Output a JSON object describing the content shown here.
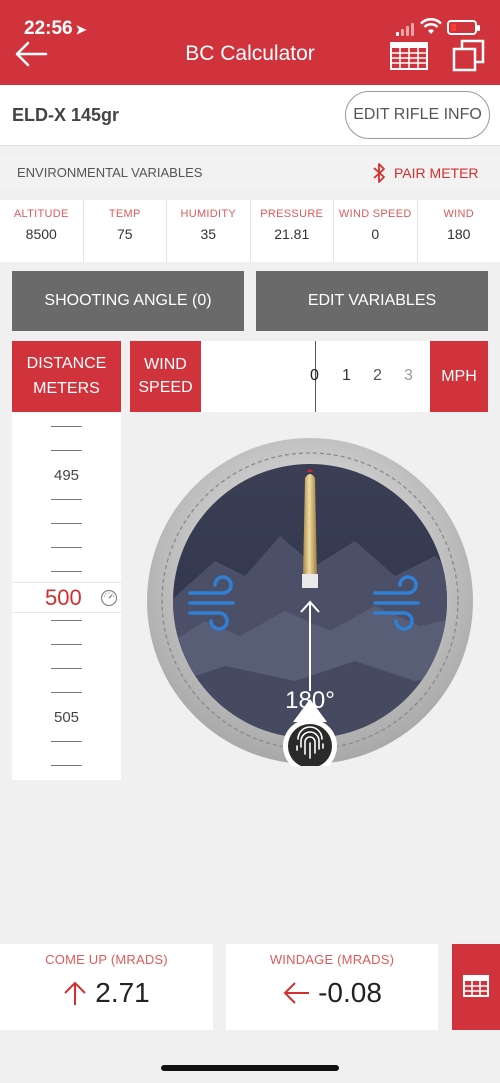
{
  "status": {
    "time": "22:56"
  },
  "header": {
    "title": "BC Calculator"
  },
  "ammo": {
    "name": "ELD-X 145gr",
    "edit_rifle_label": "EDIT RIFLE INFO"
  },
  "env": {
    "title": "ENVIRONMENTAL VARIABLES",
    "pair_meter_label": "PAIR METER",
    "items": [
      {
        "label": "ALTITUDE",
        "value": "8500"
      },
      {
        "label": "TEMP",
        "value": "75"
      },
      {
        "label": "HUMIDITY",
        "value": "35"
      },
      {
        "label": "PRESSURE",
        "value": "21.81"
      },
      {
        "label": "WIND SPEED",
        "value": "0"
      },
      {
        "label": "WIND",
        "value": "180"
      }
    ]
  },
  "buttons": {
    "shooting_angle": "SHOOTING ANGLE (0)",
    "edit_variables": "EDIT VARIABLES"
  },
  "distance": {
    "label_line1": "DISTANCE",
    "label_line2": "METERS",
    "ruler_labels": [
      "495",
      "505"
    ],
    "selected": "500"
  },
  "wind": {
    "label_line1": "WIND",
    "label_line2": "SPEED",
    "scale": [
      "0",
      "1",
      "2",
      "3"
    ],
    "unit": "MPH",
    "direction_label": "180°"
  },
  "results": {
    "come_up_label": "COME UP (MRADS)",
    "come_up_value": "2.71",
    "windage_label": "WINDAGE (MRADS)",
    "windage_value": "-0.08"
  },
  "colors": {
    "accent": "#d0333c",
    "wind_icon": "#2f80d6",
    "grey_button": "#6a6a6a"
  }
}
